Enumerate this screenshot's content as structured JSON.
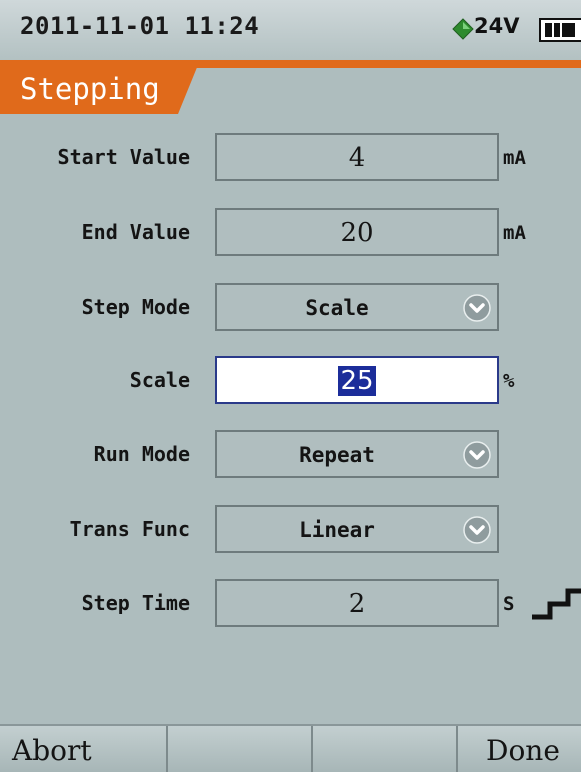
{
  "status_bar": {
    "datetime": "2011-11-01 11:24",
    "voltage": "24V",
    "power_icon": "green-diamond-power-icon",
    "battery_icon": "battery-icon"
  },
  "screen_title": "Stepping",
  "colors": {
    "title_accent": "#e06a1b",
    "background": "#aebdbe",
    "selection": "#1c2d9a"
  },
  "fields": {
    "start_value": {
      "label": "Start Value",
      "value": "4",
      "unit": "mA"
    },
    "end_value": {
      "label": "End Value",
      "value": "20",
      "unit": "mA"
    },
    "step_mode": {
      "label": "Step Mode",
      "value": "Scale"
    },
    "scale": {
      "label": "Scale",
      "value": "25",
      "unit": "%"
    },
    "run_mode": {
      "label": "Run Mode",
      "value": "Repeat"
    },
    "trans_func": {
      "label": "Trans Func",
      "value": "Linear"
    },
    "step_time": {
      "label": "Step Time",
      "value": "2",
      "unit": "S",
      "icon": "step-waveform-icon"
    }
  },
  "softkeys": {
    "key1": "Abort",
    "key2": "",
    "key3": "",
    "key4": "Done"
  }
}
